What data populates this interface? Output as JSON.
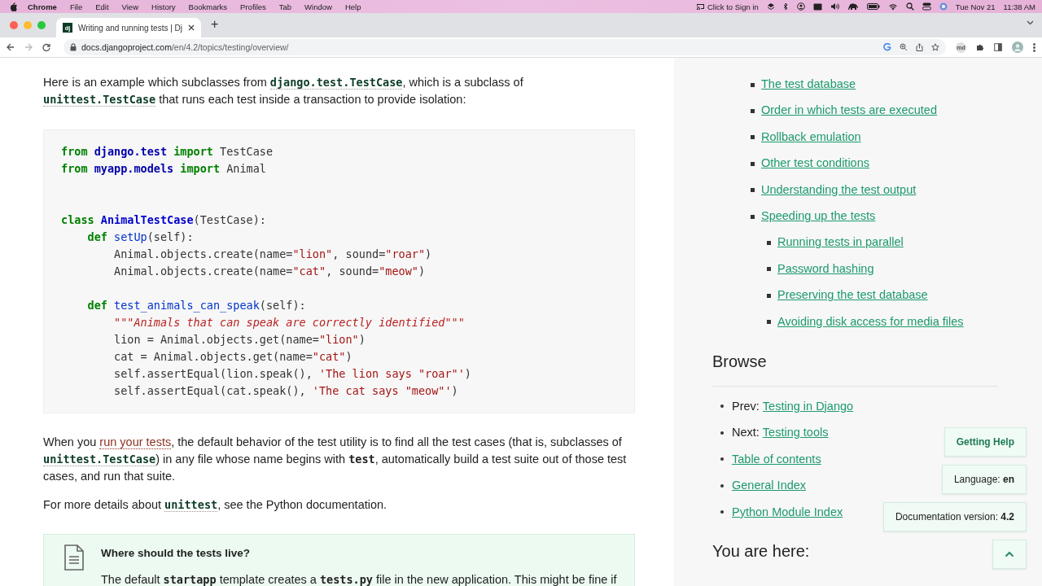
{
  "menubar": {
    "app": "Chrome",
    "items": [
      "File",
      "Edit",
      "View",
      "History",
      "Bookmarks",
      "Profiles",
      "Tab",
      "Window",
      "Help"
    ],
    "sign_in": "Click to Sign in",
    "date": "Tue Nov 21",
    "time": "11:38 AM"
  },
  "browser": {
    "tab": {
      "favicon": "dj",
      "title": "Writing and running tests | Dj",
      "selected": true
    },
    "new_tab": "+",
    "url": {
      "host": "docs.djangoproject.com",
      "path": "/en/4.2/topics/testing/overview/"
    },
    "extension": "md"
  },
  "main": {
    "intro": [
      {
        "kind": "text",
        "text": "Here is an example which subclasses from "
      },
      {
        "kind": "code",
        "text": "django.test.TestCase"
      },
      {
        "kind": "text",
        "text": ", which is a subclass of "
      },
      {
        "kind": "code",
        "text": "unittest.TestCase"
      },
      {
        "kind": "text",
        "text": " that runs each test inside a transaction to provide isolation:"
      }
    ],
    "code": [
      {
        "kind": "code",
        "tokens": [
          {
            "kind": "kw",
            "text": "from"
          },
          {
            "kind": "ns",
            "text": " django.test"
          },
          {
            "kind": "kw",
            "text": " import"
          },
          {
            "kind": "plain",
            "text": " TestCase"
          }
        ]
      },
      {
        "kind": "code",
        "tokens": [
          {
            "kind": "kw",
            "text": "from"
          },
          {
            "kind": "ns",
            "text": " myapp.models"
          },
          {
            "kind": "kw",
            "text": " import"
          },
          {
            "kind": "plain",
            "text": " Animal"
          }
        ]
      },
      {
        "kind": "blank"
      },
      {
        "kind": "blank"
      },
      {
        "kind": "code",
        "tokens": [
          {
            "kind": "kw",
            "text": "class"
          },
          {
            "kind": "cls",
            "text": " AnimalTestCase"
          },
          {
            "kind": "plain",
            "text": "(TestCase):"
          }
        ]
      },
      {
        "kind": "code",
        "tokens": [
          {
            "kind": "kw",
            "text": "    def"
          },
          {
            "kind": "fn",
            "text": " setUp"
          },
          {
            "kind": "plain",
            "text": "(self):"
          }
        ]
      },
      {
        "kind": "code",
        "tokens": [
          {
            "kind": "plain",
            "text": "        Animal.objects.create(name="
          },
          {
            "kind": "str",
            "text": "\"lion\""
          },
          {
            "kind": "plain",
            "text": ", sound="
          },
          {
            "kind": "str",
            "text": "\"roar\""
          },
          {
            "kind": "plain",
            "text": ")"
          }
        ]
      },
      {
        "kind": "code",
        "tokens": [
          {
            "kind": "plain",
            "text": "        Animal.objects.create(name="
          },
          {
            "kind": "str",
            "text": "\"cat\""
          },
          {
            "kind": "plain",
            "text": ", sound="
          },
          {
            "kind": "str",
            "text": "\"meow\""
          },
          {
            "kind": "plain",
            "text": ")"
          }
        ]
      },
      {
        "kind": "blank"
      },
      {
        "kind": "code",
        "tokens": [
          {
            "kind": "kw",
            "text": "    def"
          },
          {
            "kind": "fn",
            "text": " test_animals_can_speak"
          },
          {
            "kind": "plain",
            "text": "(self):"
          }
        ]
      },
      {
        "kind": "code",
        "tokens": [
          {
            "kind": "doc",
            "text": "        \"\"\"Animals that can speak are correctly identified\"\"\""
          }
        ]
      },
      {
        "kind": "code",
        "tokens": [
          {
            "kind": "plain",
            "text": "        lion = Animal.objects.get(name="
          },
          {
            "kind": "str",
            "text": "\"lion\""
          },
          {
            "kind": "plain",
            "text": ")"
          }
        ]
      },
      {
        "kind": "code",
        "tokens": [
          {
            "kind": "plain",
            "text": "        cat = Animal.objects.get(name="
          },
          {
            "kind": "str",
            "text": "\"cat\""
          },
          {
            "kind": "plain",
            "text": ")"
          }
        ]
      },
      {
        "kind": "code",
        "tokens": [
          {
            "kind": "plain",
            "text": "        self.assertEqual(lion.speak(), "
          },
          {
            "kind": "str",
            "text": "'The lion says \"roar\"'"
          },
          {
            "kind": "plain",
            "text": ")"
          }
        ]
      },
      {
        "kind": "code",
        "tokens": [
          {
            "kind": "plain",
            "text": "        self.assertEqual(cat.speak(), "
          },
          {
            "kind": "str",
            "text": "'The cat says \"meow\"'"
          },
          {
            "kind": "plain",
            "text": ")"
          }
        ]
      }
    ],
    "paragraphs": [
      [
        {
          "kind": "text",
          "text": "When you "
        },
        {
          "kind": "link",
          "text": "run your tests"
        },
        {
          "kind": "text",
          "text": ", the default behavior of the test utility is to find all the test cases (that is, subclasses of "
        },
        {
          "kind": "code",
          "text": "unittest.TestCase"
        },
        {
          "kind": "text",
          "text": ") in any file whose name begins with "
        },
        {
          "kind": "bold",
          "text": "test"
        },
        {
          "kind": "text",
          "text": ", automatically build a test suite out of those test cases, and run that suite."
        }
      ],
      [
        {
          "kind": "text",
          "text": "For more details about "
        },
        {
          "kind": "code",
          "text": "unittest"
        },
        {
          "kind": "text",
          "text": ", see the Python documentation."
        }
      ]
    ],
    "note": {
      "title": "Where should the tests live?",
      "text": [
        {
          "kind": "text",
          "text": "The default "
        },
        {
          "kind": "bold",
          "text": "startapp"
        },
        {
          "kind": "text",
          "text": " template creates a "
        },
        {
          "kind": "bold",
          "text": "tests.py"
        },
        {
          "kind": "text",
          "text": " file in the new application. This might be fine if"
        }
      ]
    }
  },
  "sidebar": {
    "toc": [
      {
        "label": "The test database"
      },
      {
        "label": "Order in which tests are executed"
      },
      {
        "label": "Rollback emulation"
      },
      {
        "label": "Other test conditions"
      },
      {
        "label": "Understanding the test output"
      },
      {
        "label": "Speeding up the tests",
        "children": [
          {
            "label": "Running tests in parallel"
          },
          {
            "label": "Password hashing"
          },
          {
            "label": "Preserving the test database"
          },
          {
            "label": "Avoiding disk access for media files"
          }
        ]
      }
    ],
    "browse_title": "Browse",
    "browse": [
      {
        "prefix": "Prev:",
        "link": "Testing in Django"
      },
      {
        "prefix": "Next:",
        "link": "Testing tools"
      },
      {
        "link": "Table of contents"
      },
      {
        "link": "General Index"
      },
      {
        "link": "Python Module Index"
      }
    ],
    "here_title": "You are here:"
  },
  "floating": {
    "help": "Getting Help",
    "language": "Language: **en**",
    "version": "Documentation version: **4.2**"
  }
}
